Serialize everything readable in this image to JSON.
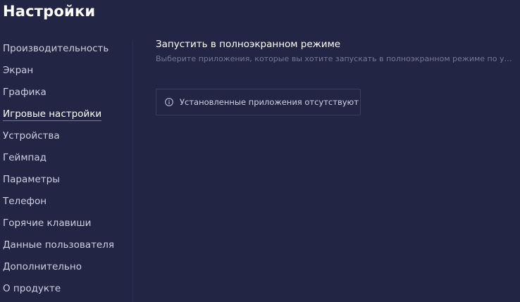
{
  "header": {
    "title": "Настройки"
  },
  "sidebar": {
    "active_index": 3,
    "items": [
      {
        "label": "Производительность"
      },
      {
        "label": "Экран"
      },
      {
        "label": "Графика"
      },
      {
        "label": "Игровые настройки"
      },
      {
        "label": "Устройства"
      },
      {
        "label": "Геймпад"
      },
      {
        "label": "Параметры"
      },
      {
        "label": "Телефон"
      },
      {
        "label": "Горячие клавиши"
      },
      {
        "label": "Данные пользователя"
      },
      {
        "label": "Дополнительно"
      },
      {
        "label": "О продукте"
      }
    ]
  },
  "main": {
    "section_title": "Запустить в полноэкранном режиме",
    "section_subtitle": "Выберите приложения, которые вы хотите запускать в полноэкранном режиме по умо...",
    "notice": {
      "icon": "info-icon",
      "text": "Установленные приложения отсутствуют"
    }
  },
  "colors": {
    "background": "#232544",
    "accent_underline": "#4f7ed8",
    "muted_text": "#757896",
    "border": "#3a3d60"
  }
}
